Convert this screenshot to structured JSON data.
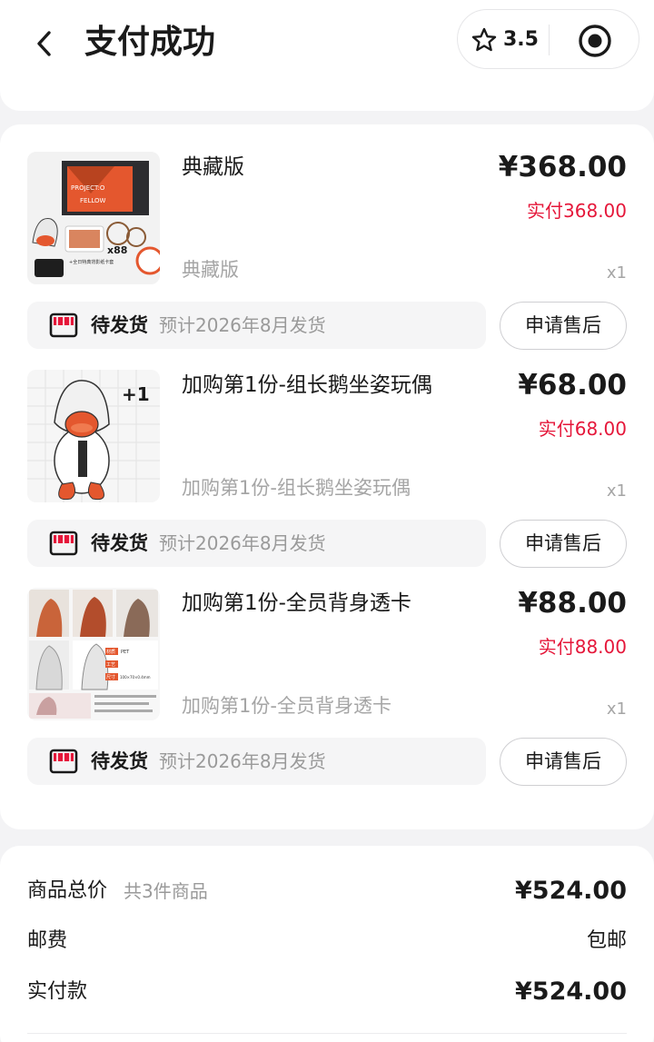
{
  "header": {
    "title": "支付成功",
    "rating": "3.5",
    "icons": [
      "back-icon",
      "star-icon",
      "target-icon"
    ]
  },
  "items": [
    {
      "name": "典藏版",
      "price": "¥368.00",
      "paid": "实付368.00",
      "spec": "典藏版",
      "qty": "x1",
      "thumb_text": [
        "PROJECT:O",
        "FELLOW",
        "x88",
        "+全日特典背影纸卡套"
      ],
      "ship_status": "待发货",
      "ship_eta": "预计2026年8月发货",
      "after_sale": "申请售后"
    },
    {
      "name": "加购第1份-组长鹅坐姿玩偶",
      "price": "¥68.00",
      "paid": "实付68.00",
      "spec": "加购第1份-组长鹅坐姿玩偶",
      "qty": "x1",
      "thumb_text": [
        "+1"
      ],
      "ship_status": "待发货",
      "ship_eta": "预计2026年8月发货",
      "after_sale": "申请售后"
    },
    {
      "name": "加购第1份-全员背身透卡",
      "price": "¥88.00",
      "paid": "实付88.00",
      "spec": "加购第1份-全员背身透卡",
      "qty": "x1",
      "thumb_text": [
        "材质",
        "工艺",
        "尺寸",
        "PET",
        "100×70×0.4mm"
      ],
      "ship_status": "待发货",
      "ship_eta": "预计2026年8月发货",
      "after_sale": "申请售后"
    }
  ],
  "summary": {
    "goods_total_label": "商品总价",
    "goods_count": "共3件商品",
    "goods_total": "¥524.00",
    "shipping_label": "邮费",
    "shipping": "包邮",
    "paid_label": "实付款",
    "paid": "¥524.00"
  },
  "colors": {
    "accent_red": "#e5173a",
    "orange": "#e4572e",
    "muted": "#a5a5a5"
  }
}
